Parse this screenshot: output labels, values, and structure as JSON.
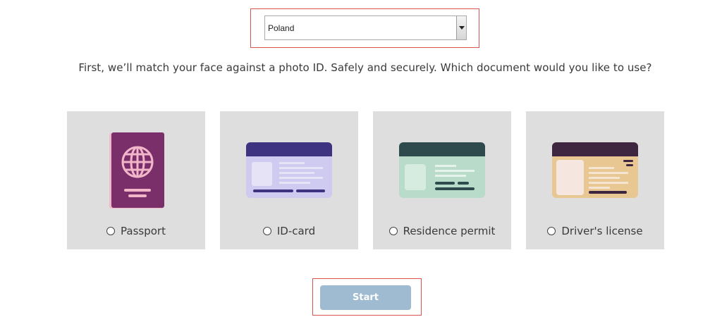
{
  "country_select": {
    "value": "Poland"
  },
  "intro_text": "First, we’ll match your face against a photo ID. Safely and securely. Which document would you like to use?",
  "documents": [
    {
      "label": "Passport",
      "icon": "passport-icon"
    },
    {
      "label": "ID-card",
      "icon": "id-card-icon"
    },
    {
      "label": "Residence permit",
      "icon": "residence-permit-icon"
    },
    {
      "label": "Driver's license",
      "icon": "drivers-license-icon"
    }
  ],
  "start_button": {
    "label": "Start"
  },
  "colors": {
    "card_background": "#dedede",
    "start_button": "#9fbbd1",
    "highlight": "#d9534f",
    "passport": "#7a2f6b",
    "id_card_header": "#3d3380",
    "residence_header": "#2f4a4d",
    "license_header": "#3e2640"
  }
}
